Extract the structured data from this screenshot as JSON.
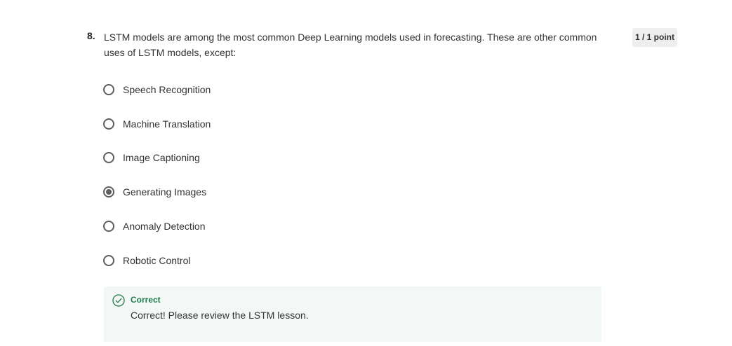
{
  "question": {
    "number": "8.",
    "text": "LSTM models are among the most common Deep Learning models used in forecasting. These are other common uses of LSTM models, except:",
    "points": "1 / 1 point"
  },
  "options": [
    {
      "label": "Speech Recognition",
      "selected": false
    },
    {
      "label": "Machine Translation",
      "selected": false
    },
    {
      "label": "Image Captioning",
      "selected": false
    },
    {
      "label": "Generating Images",
      "selected": true
    },
    {
      "label": "Anomaly Detection",
      "selected": false
    },
    {
      "label": "Robotic Control",
      "selected": false
    }
  ],
  "feedback": {
    "title": "Correct",
    "message": "Correct! Please review the LSTM lesson.",
    "icon": "check-circle-icon",
    "color": "#1e7b4a",
    "background": "#f3f8f6"
  }
}
